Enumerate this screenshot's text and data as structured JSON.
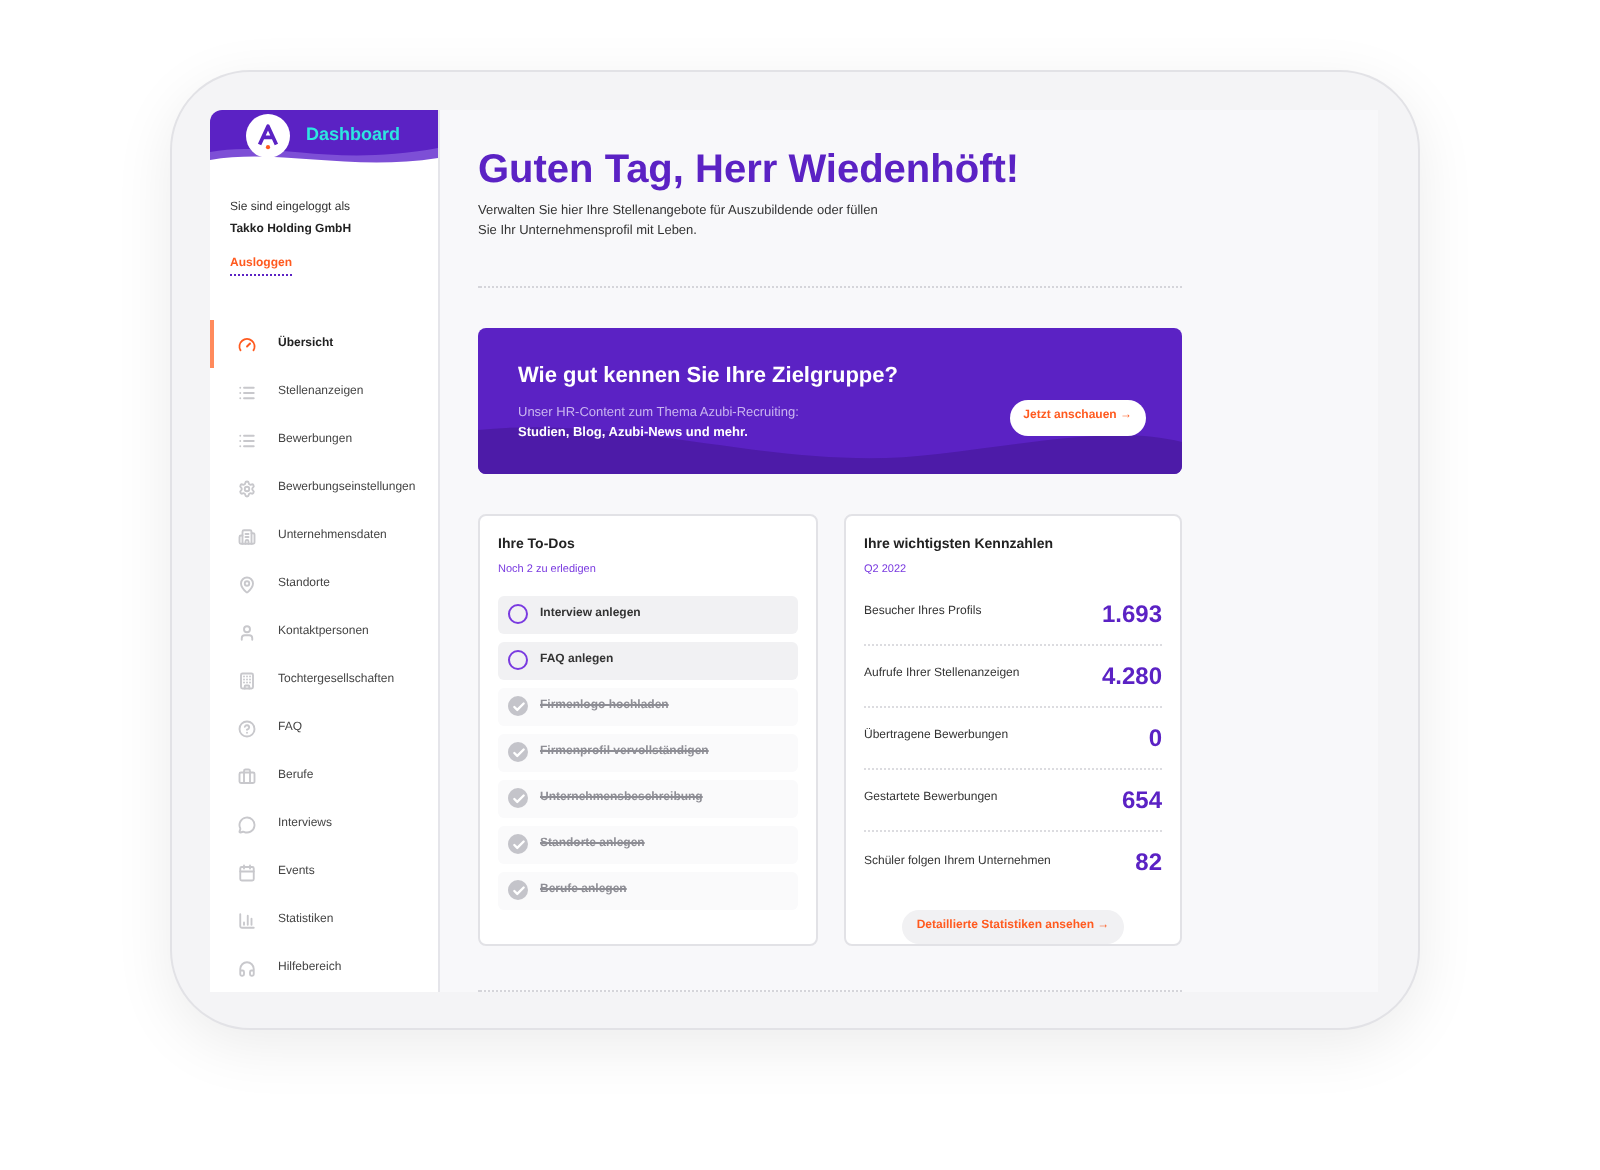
{
  "brand": {
    "name": "Dashboard"
  },
  "account": {
    "intro": "Sie sind eingeloggt als",
    "company": "Takko Holding GmbH",
    "logout": "Ausloggen"
  },
  "sidebar": {
    "items": [
      {
        "label": "Übersicht",
        "selected": true
      },
      {
        "label": "Stellenanzeigen",
        "selected": false
      },
      {
        "label": "Bewerbungen",
        "selected": false
      },
      {
        "label": "Bewerbungseinstellungen",
        "selected": false
      },
      {
        "label": "Unternehmensdaten",
        "selected": false
      },
      {
        "label": "Standorte",
        "selected": false
      },
      {
        "label": "Kontaktpersonen",
        "selected": false
      },
      {
        "label": "Tochtergesellschaften",
        "selected": false
      },
      {
        "label": "FAQ",
        "selected": false
      },
      {
        "label": "Berufe",
        "selected": false
      },
      {
        "label": "Interviews",
        "selected": false
      },
      {
        "label": "Events",
        "selected": false
      },
      {
        "label": "Statistiken",
        "selected": false
      },
      {
        "label": "Hilfebereich",
        "selected": false
      }
    ]
  },
  "greeting": {
    "title": "Guten Tag, Herr Wiedenhöft!",
    "text": "Verwalten Sie hier Ihre Stellenangebote für Auszubildende oder füllen Sie Ihr Unternehmensprofil mit Leben."
  },
  "banner": {
    "title": "Wie gut kennen Sie Ihre Zielgruppe?",
    "line_1": "Unser HR-Content zum Thema Azubi-Recruiting:",
    "line_2": "Studien, Blog, Azubi-News und mehr.",
    "button": "Jetzt anschauen →"
  },
  "todos": {
    "title": "Ihre To-Dos",
    "subtitle": "Noch 2 zu erledigen",
    "items": [
      {
        "label": "Interview anlegen",
        "checked": false
      },
      {
        "label": "FAQ anlegen",
        "checked": false
      },
      {
        "label": "Firmenlogo hochladen",
        "checked": true
      },
      {
        "label": "Firmenprofil vervollständigen",
        "checked": true
      },
      {
        "label": "Unternehmensbeschreibung",
        "checked": true
      },
      {
        "label": "Standorte anlegen",
        "checked": true
      },
      {
        "label": "Berufe anlegen",
        "checked": true
      }
    ]
  },
  "stats": {
    "title": "Ihre wichtigsten Kennzahlen",
    "subtitle": "Q2 2022",
    "rows": [
      {
        "label": "Besucher Ihres Profils",
        "value": "1.693"
      },
      {
        "label": "Aufrufe Ihrer Stellenanzeigen",
        "value": "4.280"
      },
      {
        "label": "Übertragene Bewerbungen",
        "value": "0"
      },
      {
        "label": "Gestartete Bewerbungen",
        "value": "654"
      },
      {
        "label": "Schüler folgen Ihrem Unternehmen",
        "value": "82"
      }
    ],
    "button": "Detaillierte Statistiken ansehen →"
  }
}
